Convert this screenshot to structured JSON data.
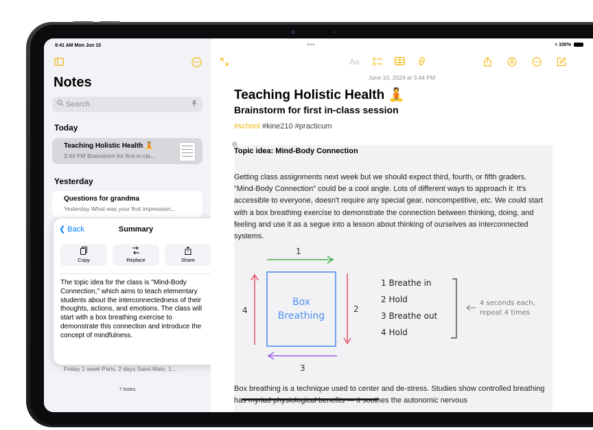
{
  "status": {
    "time": "9:41 AM  Mon Jun 10",
    "battery": "100%"
  },
  "sidebar": {
    "title": "Notes",
    "search_placeholder": "Search",
    "sections": [
      {
        "header": "Today"
      },
      {
        "header": "Yesterday"
      }
    ],
    "notes": [
      {
        "title": "Teaching Holistic Health 🧘",
        "subtitle": "3:44 PM  Brainstorm for first in-cla..."
      },
      {
        "title": "Questions for grandma",
        "subtitle": "Yesterday  What was your first impression..."
      },
      {
        "subtitle": "Friday  1 week Paris, 2 days Saint-Malo, 1..."
      }
    ],
    "count": "7 Notes"
  },
  "summary": {
    "back": "Back",
    "title": "Summary",
    "actions": [
      "Copy",
      "Replace",
      "Share"
    ],
    "text": "The topic idea for the class is \"Mind-Body Connection,\" which aims to teach elementary students about the interconnectedness of their thoughts, actions, and emotions. The class will start with a box breathing exercise to demonstrate this connection and introduce the concept of mindfulness."
  },
  "note": {
    "date": "June 10, 2024 at 3:44 PM",
    "title": "Teaching Holistic Health 🧘",
    "subtitle": "Brainstorm for first in-class session",
    "tags": {
      "highlighted": "#school",
      "rest": " #kine210 #practicum"
    },
    "topic": "Topic idea: Mind-Body Connection",
    "paragraph1": "Getting class assignments next week but we should expect third, fourth, or fifth graders. \"Mind-Body Connection\" could be a cool angle. Lots of different ways to approach it: It's accessible to everyone, doesn't require any special gear, noncompetitive, etc. We could start with a box breathing exercise to demonstrate the connection between thinking, doing, and feeling and use it as a segue into a lesson about thinking of ourselves as interconnected systems.",
    "sketch": {
      "box_label_1": "Box",
      "box_label_2": "Breathing",
      "side_numbers": [
        "1",
        "2",
        "3",
        "4"
      ],
      "steps": [
        "1  Breathe in",
        "2  Hold",
        "3  Breathe out",
        "4  Hold"
      ],
      "note_1": "4 seconds each,",
      "note_2": "repeat 4 times"
    },
    "paragraph2": "Box breathing is a technique used to center and de-stress. Studies show controlled breathing has myriad physiological benefits — it soothes the autonomic nervous"
  },
  "colors": {
    "accent": "#f2b80f",
    "link": "#007aff"
  }
}
